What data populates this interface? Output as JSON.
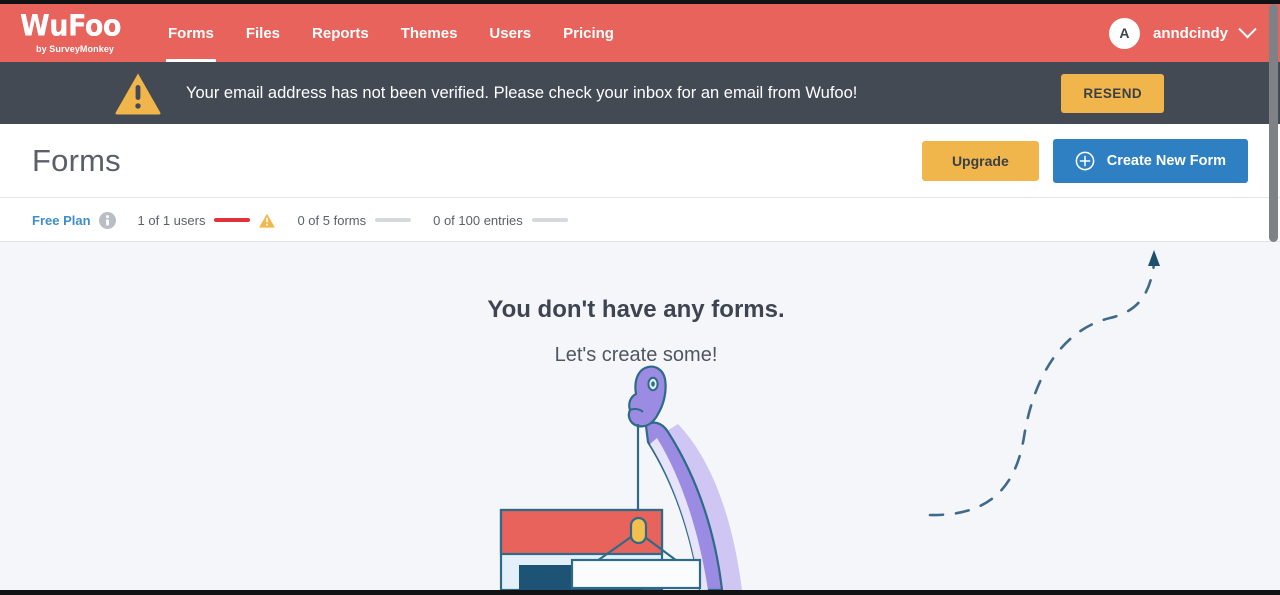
{
  "brand": {
    "logo_word": "WuFoo",
    "logo_sub": "by SurveyMonkey",
    "nav_bg": "#e8635c",
    "banner_bg": "#434a54",
    "accent_amber": "#f0b64b",
    "accent_blue": "#2f80c2",
    "link_blue": "#3f8ecc",
    "content_bg": "#f4f6fa"
  },
  "topnav": {
    "items": [
      {
        "label": "Forms",
        "active": true
      },
      {
        "label": "Files",
        "active": false
      },
      {
        "label": "Reports",
        "active": false
      },
      {
        "label": "Themes",
        "active": false
      },
      {
        "label": "Users",
        "active": false
      },
      {
        "label": "Pricing",
        "active": false
      }
    ],
    "user": {
      "avatar_initial": "A",
      "name": "anndcindy",
      "chevron": "chevron-down-icon"
    }
  },
  "banner": {
    "icon": "warning-triangle-icon",
    "message": "Your email address has not been verified. Please check your inbox for an email from Wufoo!",
    "action_label": "RESEND"
  },
  "page": {
    "title": "Forms",
    "upgrade_label": "Upgrade",
    "create_label": "Create New Form",
    "create_icon": "plus-circle-icon"
  },
  "usage": {
    "plan_label": "Free Plan",
    "info_icon": "info-icon",
    "metrics": [
      {
        "label": "1 of 1 users",
        "meter_state": "full",
        "warning": true
      },
      {
        "label": "0 of 5 forms",
        "meter_state": "empty",
        "warning": false
      },
      {
        "label": "0 of 100 entries",
        "meter_state": "empty",
        "warning": false
      }
    ]
  },
  "empty_state": {
    "heading": "You don't have any forms.",
    "subheading": "Let's create some!",
    "illustration": "dinosaur-building-form-illustration",
    "arrow": "dashed-curved-arrow-icon"
  }
}
